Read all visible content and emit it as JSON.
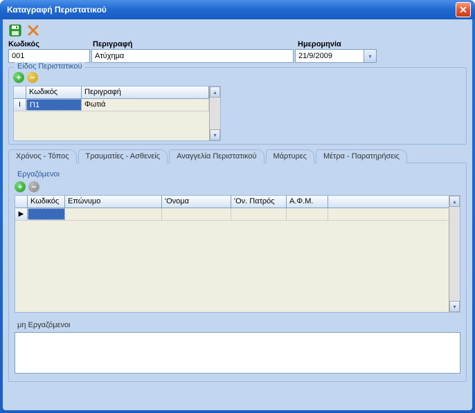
{
  "window": {
    "title": "Καταγραφή Περιστατικού"
  },
  "fields": {
    "code_label": "Κωδικός",
    "code_value": "001",
    "desc_label": "Περιγραφή",
    "desc_value": "Ατύχημα",
    "date_label": "Ημερομηνία",
    "date_value": "21/9/2009"
  },
  "incident_type": {
    "title": "Είδος Περιστατικού",
    "cols": {
      "code": "Κωδικός",
      "desc": "Περιγραφή"
    },
    "rows": [
      {
        "code": "Π1",
        "desc": "Φωτιά"
      }
    ]
  },
  "tabs": {
    "t0": "Χρόνος - Τόπος",
    "t1": "Τραυματίες - Ασθενείς",
    "t2": "Αναγγελία Περιστατικού",
    "t3": "Μάρτυρες",
    "t4": "Μέτρα - Παρατηρήσεις"
  },
  "witnesses": {
    "emp_title": "Εργαζόμενοι",
    "cols": {
      "code": "Κωδικός",
      "surname": "Επώνυμο",
      "name": "'Ονομα",
      "father": "'Ον. Πατρός",
      "afm": "Α.Φ.Μ."
    },
    "nonemp_title": "μη Εργαζόμενοι",
    "nonemp_value": ""
  },
  "icons": {
    "add": "+",
    "remove": "−",
    "close": "✕",
    "dropdown": "▾",
    "scroll_up": "▴",
    "scroll_down": "▾",
    "row_marker": "▶",
    "edit_marker": "I"
  }
}
